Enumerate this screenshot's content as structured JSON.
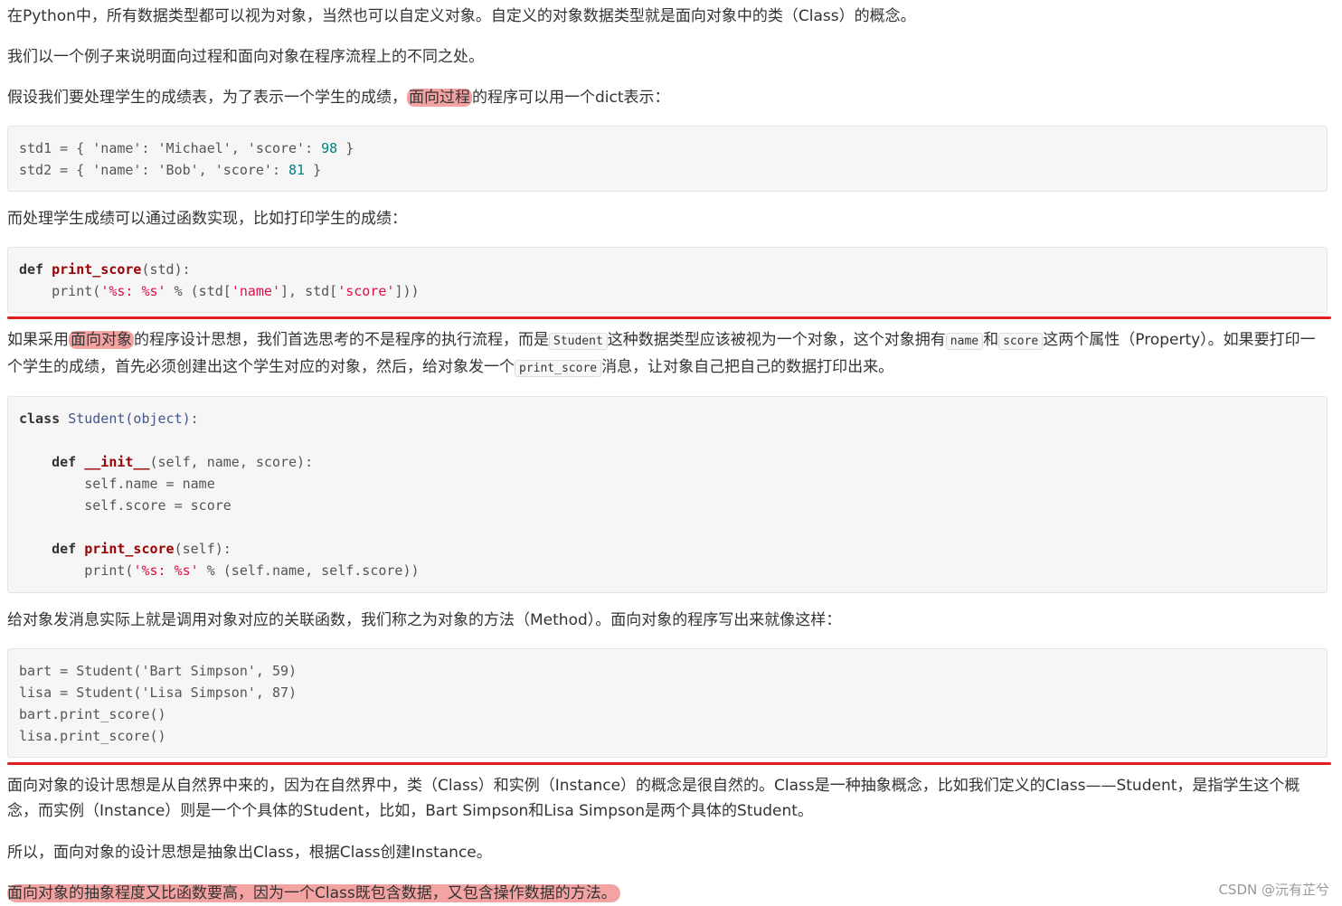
{
  "paragraphs": {
    "p1": "在Python中，所有数据类型都可以视为对象，当然也可以自定义对象。自定义的对象数据类型就是面向对象中的类（Class）的概念。",
    "p2": "我们以一个例子来说明面向过程和面向对象在程序流程上的不同之处。",
    "p3_before": "假设我们要处理学生的成绩表，为了表示一个学生的成绩，",
    "p3_highlight": "面向过程",
    "p3_after": "的程序可以用一个dict表示：",
    "p4": "而处理学生成绩可以通过函数实现，比如打印学生的成绩：",
    "p5_before": "如果采用",
    "p5_highlight": "面向对象",
    "p5_mid1": "的程序设计思想，我们首选思考的不是程序的执行流程，而是",
    "p5_code1": "Student",
    "p5_mid2": "这种数据类型应该被视为一个对象，这个对象拥有",
    "p5_code2": "name",
    "p5_mid3": "和",
    "p5_code3": "score",
    "p5_mid4": "这两个属性（Property）。如果要打印一个学生的成绩，首先必须创建出这个学生对应的对象，然后，给对象发一个",
    "p5_code4": "print_score",
    "p5_after": "消息，让对象自己把自己的数据打印出来。",
    "p6": "给对象发消息实际上就是调用对象对应的关联函数，我们称之为对象的方法（Method）。面向对象的程序写出来就像这样：",
    "p7": "面向对象的设计思想是从自然界中来的，因为在自然界中，类（Class）和实例（Instance）的概念是很自然的。Class是一种抽象概念，比如我们定义的Class——Student，是指学生这个概念，而实例（Instance）则是一个个具体的Student，比如，Bart Simpson和Lisa Simpson是两个具体的Student。",
    "p8": "所以，面向对象的设计思想是抽象出Class，根据Class创建Instance。",
    "p9": "面向对象的抽象程度又比函数要高，因为一个Class既包含数据，又包含操作数据的方法。"
  },
  "code1": {
    "l1_a": "std1 = { 'name': 'Michael', 'score': ",
    "l1_num": "98",
    "l1_b": " }",
    "l2_a": "std2 = { 'name': 'Bob', 'score': ",
    "l2_num": "81",
    "l2_b": " }"
  },
  "code2": {
    "kw_def": "def",
    "fn": "print_score",
    "sig": "(std):",
    "l2_a": "    print(",
    "l2_s1": "'%s: %s'",
    "l2_b": " % (std[",
    "l2_s2": "'name'",
    "l2_c": "], std[",
    "l2_s3": "'score'",
    "l2_d": "]))"
  },
  "code3": {
    "kw_class": "class",
    "cls": "Student(object):",
    "kw_def1": "def",
    "fn1": "__init__",
    "sig1": "(self, name, score):",
    "body1a": "        self.name = name",
    "body1b": "        self.score = score",
    "kw_def2": "def",
    "fn2": "print_score",
    "sig2": "(self):",
    "p_a": "        print(",
    "p_s": "'%s: %s'",
    "p_b": " % (self.name, self.score))"
  },
  "code4": {
    "l1": "bart = Student('Bart Simpson', 59)",
    "l2": "lisa = Student('Lisa Simpson', 87)",
    "l3": "bart.print_score()",
    "l4": "lisa.print_score()"
  },
  "watermark": "CSDN @沅有芷兮",
  "colors": {
    "highlight": "#f4a3a3",
    "rule": "#e02020"
  }
}
